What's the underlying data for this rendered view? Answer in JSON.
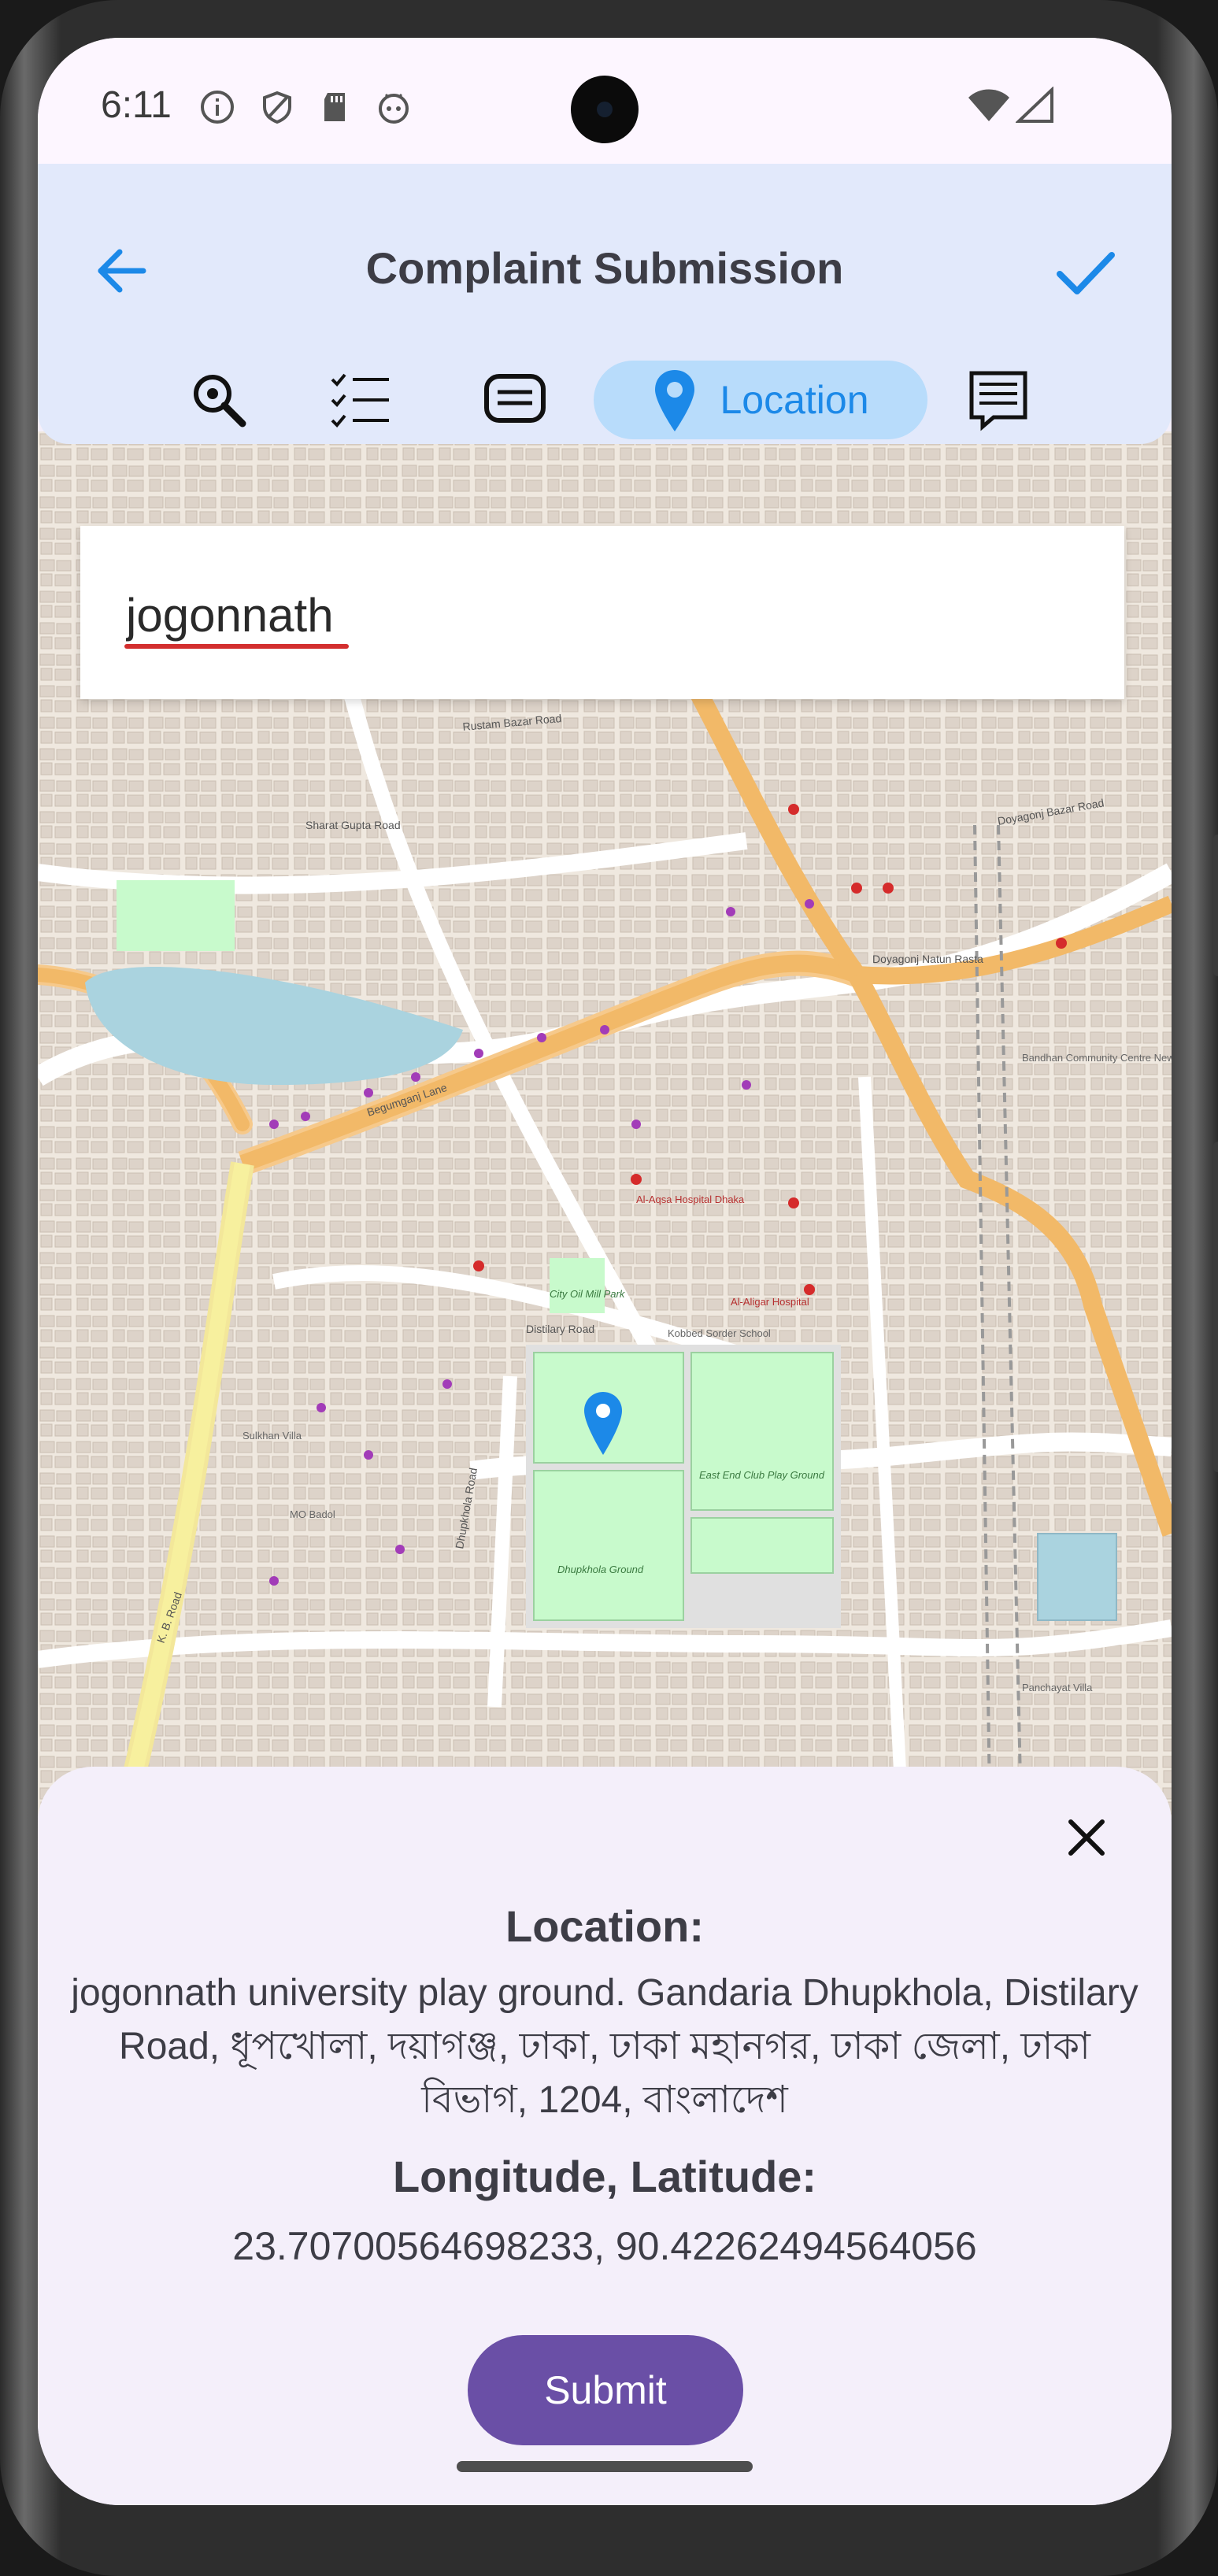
{
  "status_bar": {
    "time": "6:11"
  },
  "app_bar": {
    "title": "Complaint Submission",
    "active_tab_label": "Location",
    "tabs": [
      "search-icon",
      "checklist-icon",
      "chat-icon",
      "location-pin-icon",
      "notes-icon"
    ]
  },
  "search": {
    "value": "jogonnath"
  },
  "map_labels": {
    "streets": [
      "Sharat Gupta Road",
      "Begumganj Lane",
      "Distilary Road",
      "Doyagonj Natun Rasta",
      "Doyagonj Bazar Road",
      "K. B. Road",
      "Dhupkhola Road",
      "Rustam Bazar Road"
    ],
    "places": [
      "Dhupkhola Ground",
      "East End Club Play Ground",
      "City Oil Mill Park",
      "Al-Aqsa Hospital Dhaka",
      "Al-Aligar Hospital",
      "Kobbed Sorder School",
      "MO Badol",
      "Sulkhan Villa",
      "Bandhan Community Centre New Road",
      "Panchayat Villa"
    ]
  },
  "sheet": {
    "location_label": "Location:",
    "address": "jogonnath university play ground. Gandaria Dhupkhola, Distilary Road, ধূপখোলা, দয়াগঞ্জ, ঢাকা, ঢাকা মহানগর, ঢাকা জেলা, ঢাকা বিভাগ, 1204, বাংলাদেশ",
    "coords_label": "Longitude, Latitude:",
    "coords": "23.70700564698233, 90.42262494564056",
    "submit_label": "Submit"
  },
  "colors": {
    "accent": "#1c89e8",
    "submit": "#6a4fa6",
    "appbar": "#e2e9fb",
    "sheet": "#f4effa"
  }
}
